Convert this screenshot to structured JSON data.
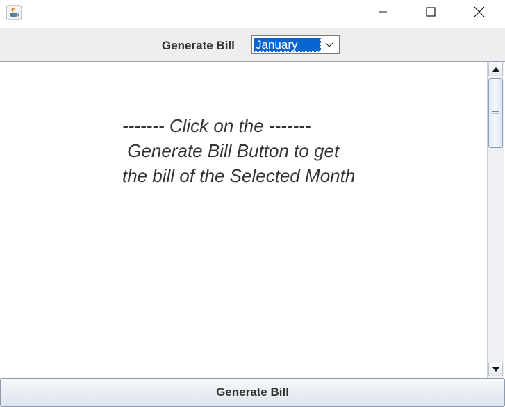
{
  "window": {
    "icons": {
      "app": "java-coffee-cup-icon",
      "minimize": "minimize-icon",
      "maximize": "maximize-icon",
      "close": "close-icon"
    }
  },
  "toolbar": {
    "label": "Generate Bill",
    "month_select": {
      "selected": "January",
      "icon": "chevron-down-icon"
    }
  },
  "message": {
    "line1": "------- Click on the -------",
    "line2": " Generate Bill Button to get",
    "line3": "the bill of the Selected Month"
  },
  "footer": {
    "button_label": "Generate Bill"
  },
  "colors": {
    "selection": "#0a64d2",
    "text": "#333333",
    "toolbar_bg": "#eeeeee"
  }
}
